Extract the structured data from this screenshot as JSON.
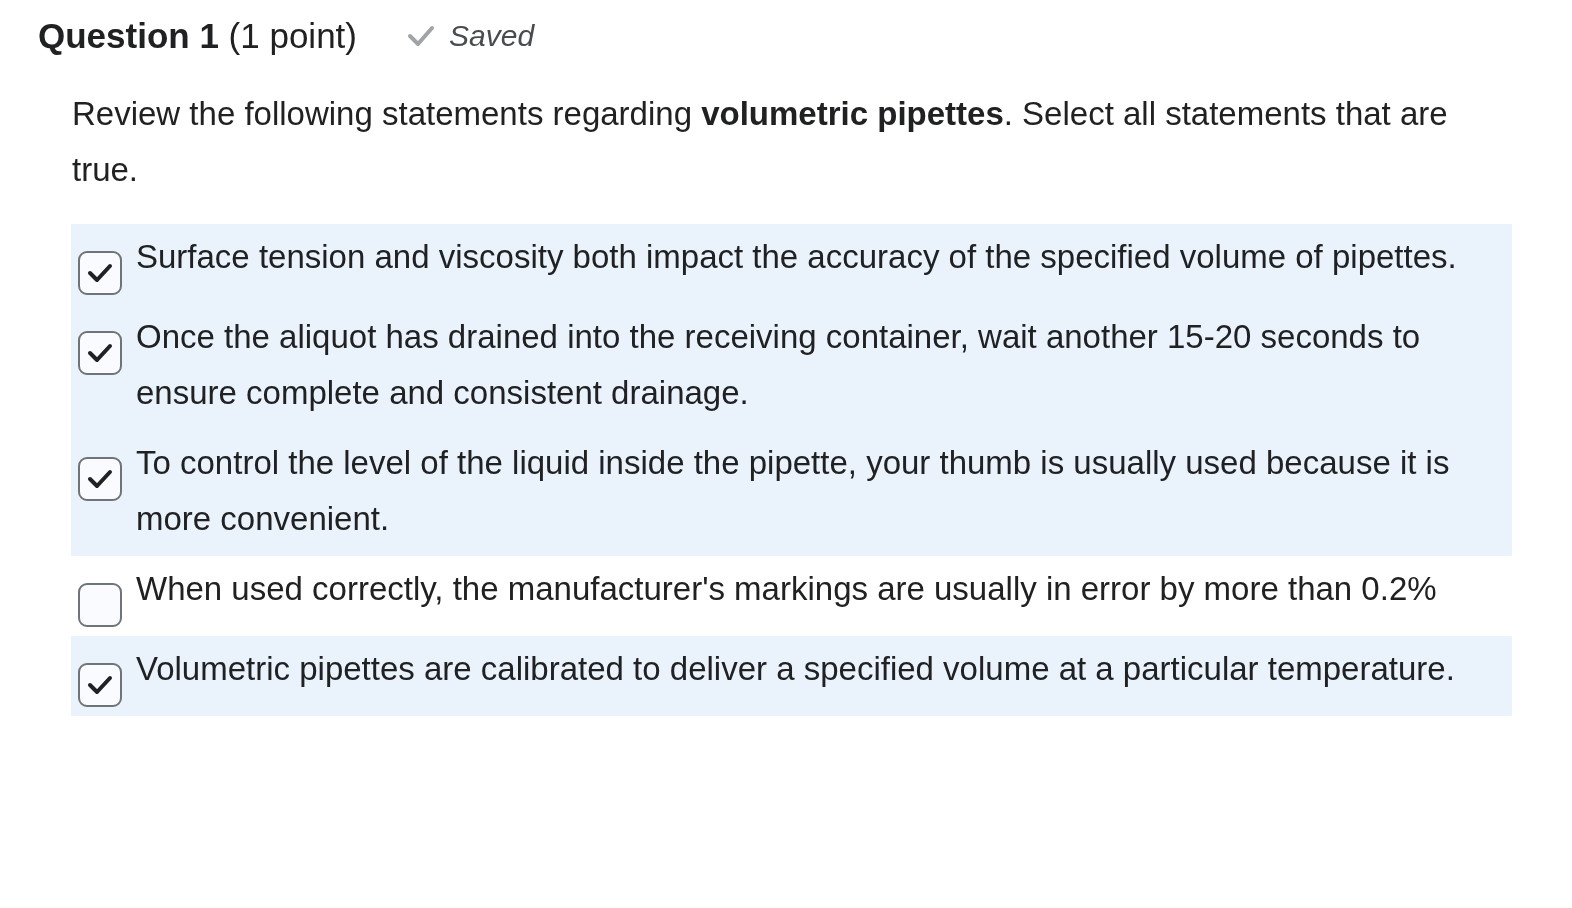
{
  "question": {
    "title": "**Question 1** (1 point)",
    "status": "Saved",
    "prompt": "Review the following statements regarding **volumetric pipettes**. Select all statements that are true.",
    "options": [
      {
        "text": "Surface tension and viscosity both impact the accuracy of the specified volume of pipettes.",
        "checked": true
      },
      {
        "text": "Once the aliquot has drained into the receiving container, wait another 15-20 seconds to ensure complete and consistent drainage.",
        "checked": true
      },
      {
        "text": "To control the level of the liquid inside the pipette, your thumb is usually used because it is more convenient.",
        "checked": true
      },
      {
        "text": "When used correctly, the manufacturer's markings are usually in error by more than 0.2%",
        "checked": false
      },
      {
        "text": "Volumetric pipettes are calibrated to deliver a specified volume at a particular temperature.",
        "checked": true
      }
    ]
  }
}
